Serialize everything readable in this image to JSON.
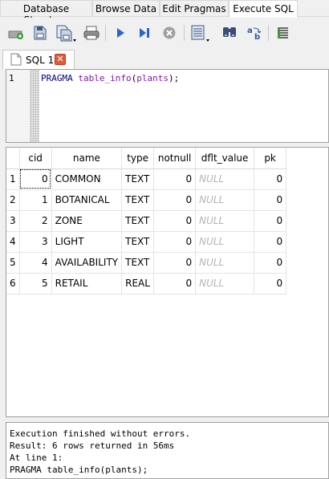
{
  "main_tabs": [
    "Database Structure",
    "Browse Data",
    "Edit Pragmas",
    "Execute SQL"
  ],
  "toolbar": {
    "icons": [
      "open-tab-icon",
      "open-sql-icon",
      "save-sql-icon",
      "print-icon",
      "execute-all-icon",
      "execute-line-icon",
      "stop-icon",
      "save-results-icon",
      "find-icon",
      "find-replace-icon",
      "comment-icon"
    ]
  },
  "sql_tab": {
    "label": "SQL 1",
    "close_glyph": "✕"
  },
  "editor": {
    "line_number": "1",
    "keyword": "PRAGMA",
    "function": "table_info",
    "open_paren": "(",
    "table": "plants",
    "close": ");",
    "space": " "
  },
  "results": {
    "columns": [
      "cid",
      "name",
      "type",
      "notnull",
      "dflt_value",
      "pk"
    ],
    "rows": [
      {
        "rownum": "1",
        "cid": "0",
        "name": "COMMON",
        "type": "TEXT",
        "notnull": "0",
        "dflt_value": "NULL",
        "pk": "0"
      },
      {
        "rownum": "2",
        "cid": "1",
        "name": "BOTANICAL",
        "type": "TEXT",
        "notnull": "0",
        "dflt_value": "NULL",
        "pk": "0"
      },
      {
        "rownum": "3",
        "cid": "2",
        "name": "ZONE",
        "type": "TEXT",
        "notnull": "0",
        "dflt_value": "NULL",
        "pk": "0"
      },
      {
        "rownum": "4",
        "cid": "3",
        "name": "LIGHT",
        "type": "TEXT",
        "notnull": "0",
        "dflt_value": "NULL",
        "pk": "0"
      },
      {
        "rownum": "5",
        "cid": "4",
        "name": "AVAILABILITY",
        "type": "TEXT",
        "notnull": "0",
        "dflt_value": "NULL",
        "pk": "0"
      },
      {
        "rownum": "6",
        "cid": "5",
        "name": "RETAIL",
        "type": "REAL",
        "notnull": "0",
        "dflt_value": "NULL",
        "pk": "0"
      }
    ]
  },
  "messages": [
    "Execution finished without errors.",
    "Result: 6 rows returned in 56ms",
    "At line 1:",
    "PRAGMA table_info(plants);"
  ],
  "colors": {
    "keyword": "#000080",
    "identifier": "#7a1ba8",
    "null_text": "#b4b4b4",
    "close_button": "#e05a3a"
  }
}
